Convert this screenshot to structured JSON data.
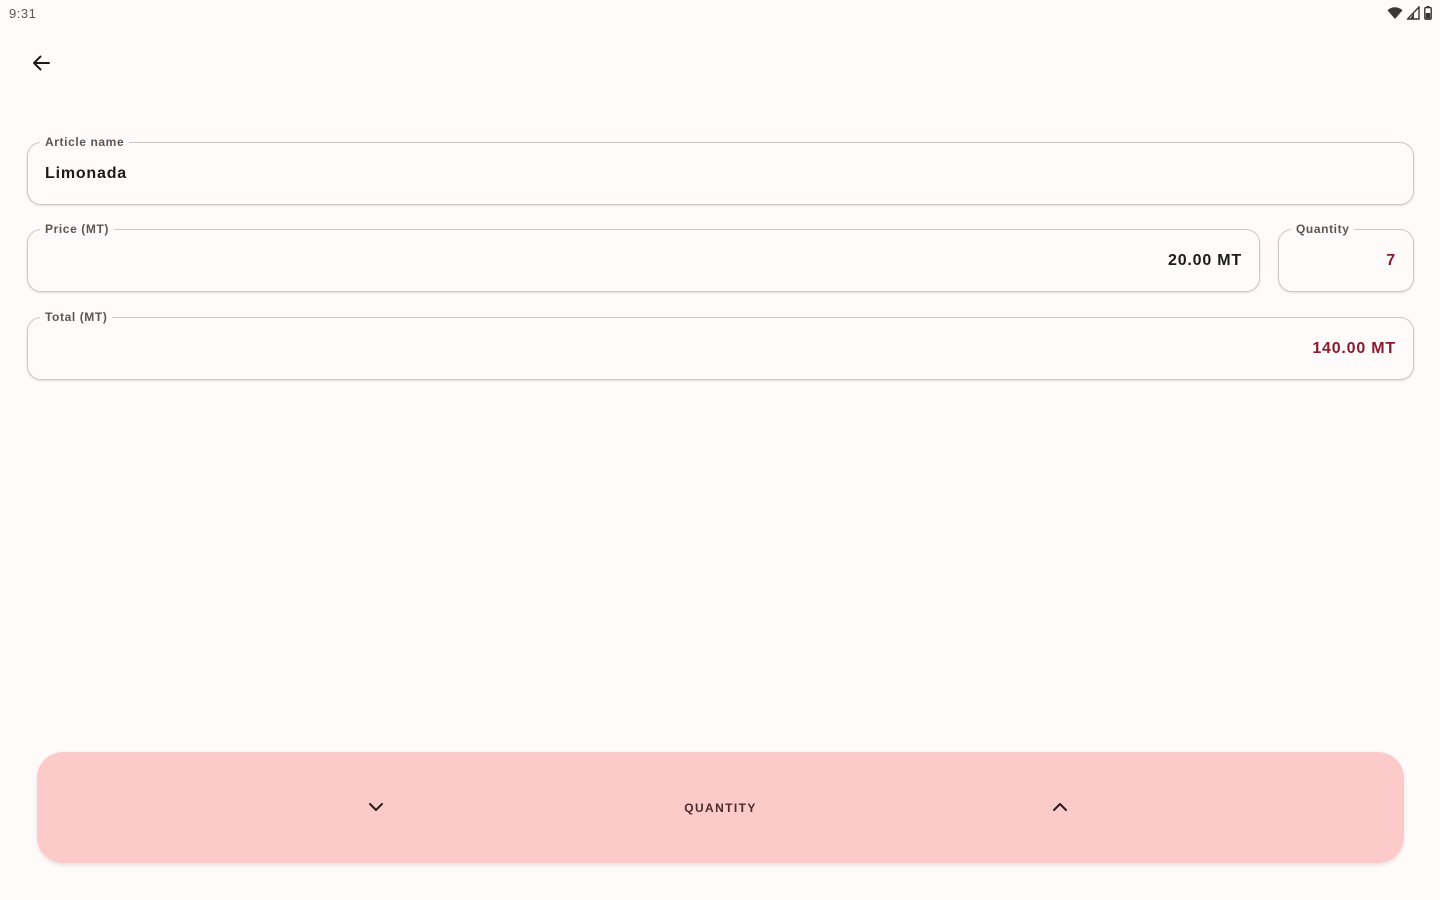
{
  "status_bar": {
    "time": "9:31",
    "icons": [
      "wifi-icon",
      "cellular-signal-icon",
      "battery-icon"
    ]
  },
  "toolbar": {
    "back_icon": "arrow-back-icon"
  },
  "form": {
    "article_name": {
      "label": "Article name",
      "value": "Limonada"
    },
    "price": {
      "label": "Price (MT)",
      "value": "20.00 MT"
    },
    "quantity": {
      "label": "Quantity",
      "value": "7"
    },
    "total": {
      "label": "Total (MT)",
      "value": "140.00 MT"
    }
  },
  "stepper": {
    "label": "QUANTITY",
    "decrement_icon": "chevron-down-icon",
    "increment_icon": "chevron-up-icon"
  },
  "colors": {
    "background": "#fffbfb",
    "stepper_background": "#fccbc9",
    "accent_value": "#8a1a2e",
    "outline": "#cfc7c7"
  }
}
